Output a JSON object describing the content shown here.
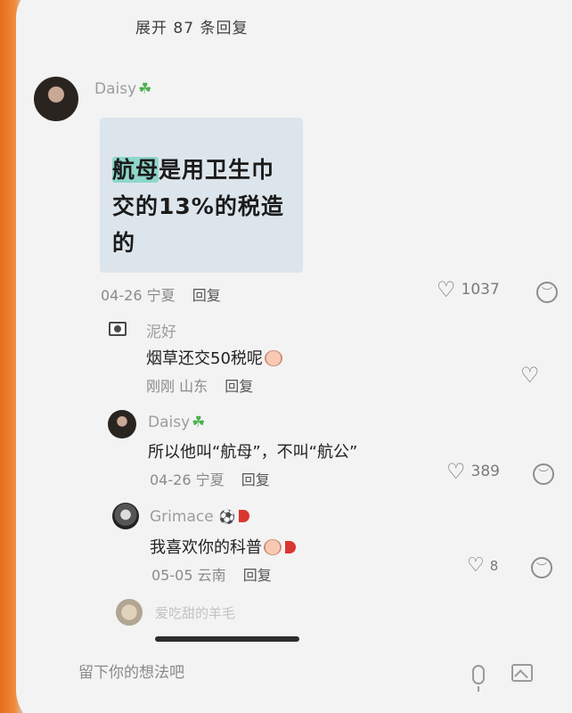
{
  "header": {
    "expand_replies": "展开 87 条回复"
  },
  "main_comment": {
    "username": "Daisy",
    "image_text_highlight": "航母",
    "image_text_rest": "是用卫生巾交的13%的税造的",
    "date": "04-26",
    "location": "宁夏",
    "reply_label": "回复",
    "likes": "1037"
  },
  "replies": [
    {
      "username": "泥好",
      "text": "烟草还交50税呢",
      "date": "刚刚",
      "location": "山东",
      "reply_label": "回复",
      "likes": ""
    },
    {
      "username": "Daisy",
      "text": "所以他叫“航母”，不叫“航公”",
      "date": "04-26",
      "location": "宁夏",
      "reply_label": "回复",
      "likes": "389"
    },
    {
      "username": "Grimace",
      "text": "我喜欢你的科普",
      "date": "05-05",
      "location": "云南",
      "reply_label": "回复",
      "likes": "8"
    },
    {
      "username": "爱吃甜的羊毛"
    }
  ],
  "input": {
    "placeholder": "留下你的想法吧"
  },
  "icons": {
    "clover": "four-leaf-clover",
    "like": "heart-outline",
    "dislike": "frown-face",
    "mic": "microphone",
    "image": "image-picker"
  },
  "colors": {
    "accent_highlight": "#8fd6cb",
    "frame_orange": "#ea7a2c"
  }
}
